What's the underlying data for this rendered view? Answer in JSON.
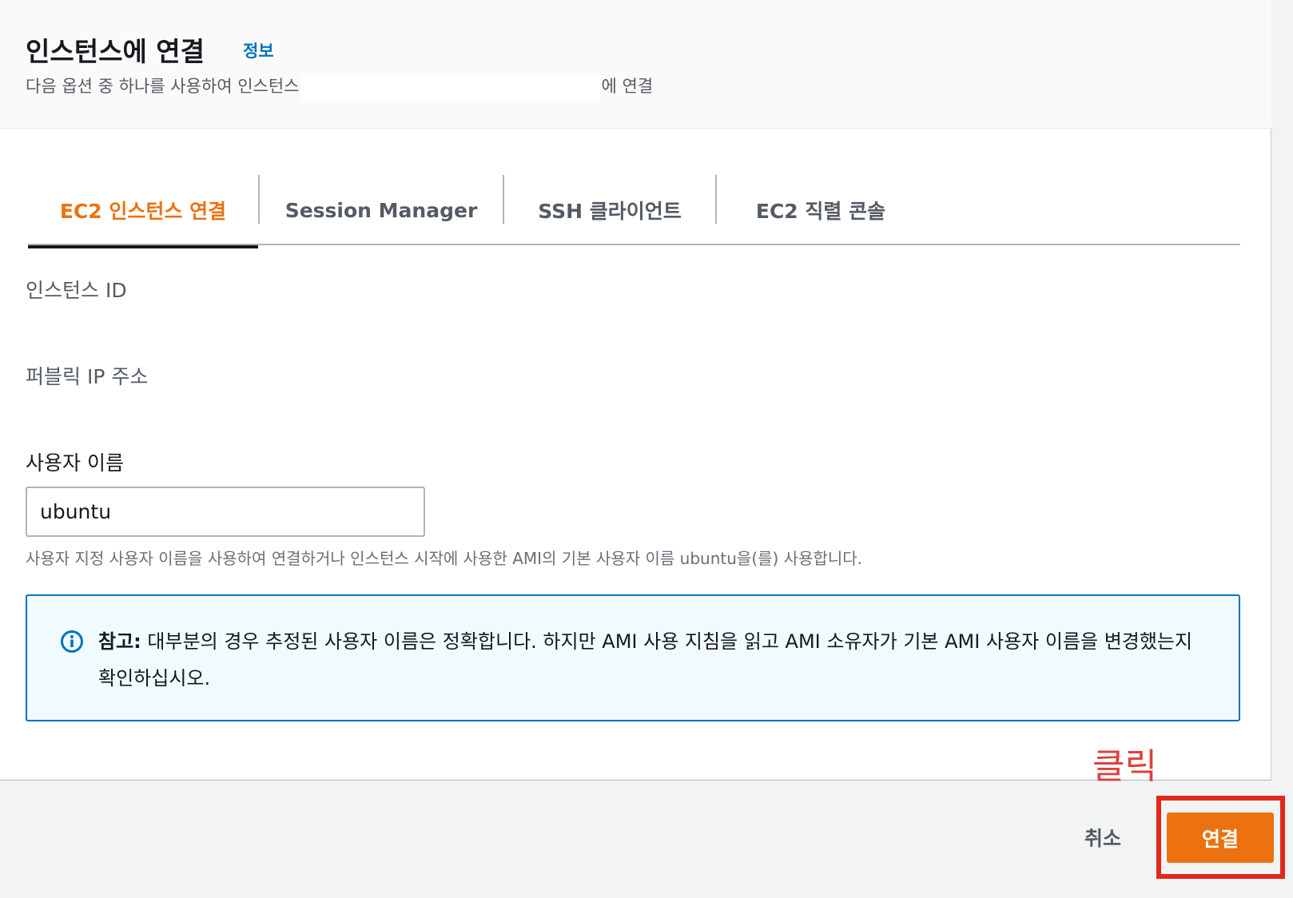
{
  "header": {
    "title": "인스턴스에 연결",
    "info_link": "정보",
    "subtitle_prefix": "다음 옵션 중 하나를 사용하여 인스턴스",
    "subtitle_suffix": "에 연결"
  },
  "tabs": [
    {
      "label": "EC2 인스턴스 연결",
      "active": true
    },
    {
      "label": "Session Manager",
      "active": false
    },
    {
      "label": "SSH 클라이언트",
      "active": false
    },
    {
      "label": "EC2 직렬 콘솔",
      "active": false
    }
  ],
  "fields": {
    "instance_id_label": "인스턴스 ID",
    "public_ip_label": "퍼블릭 IP 주소",
    "username_label": "사용자 이름",
    "username_value": "ubuntu",
    "username_hint": "사용자 지정 사용자 이름을 사용하여 연결하거나 인스턴스 시작에 사용한 AMI의 기본 사용자 이름 ubuntu을(를) 사용합니다."
  },
  "alert": {
    "icon": "info-circle-icon",
    "prefix": "참고:",
    "text": "대부분의 경우 추정된 사용자 이름은 정확합니다. 하지만 AMI 사용 지침을 읽고 AMI 소유자가 기본 AMI 사용자 이름을 변경했는지 확인하십시오."
  },
  "annotation": {
    "text": "클릭",
    "color": "#e0403a"
  },
  "footer": {
    "cancel_label": "취소",
    "connect_label": "연결"
  },
  "colors": {
    "accent": "#ec7211",
    "link": "#0073bb",
    "highlight": "#e2281b"
  }
}
